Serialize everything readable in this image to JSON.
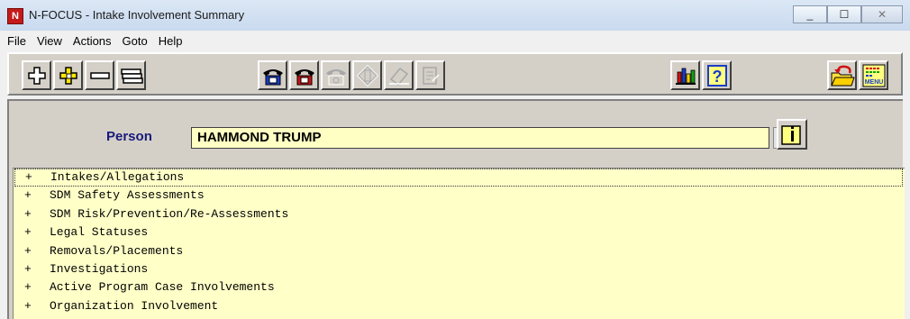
{
  "window": {
    "title": "N-FOCUS - Intake Involvement Summary",
    "app_icon_text": "N",
    "minimize": "_",
    "maximize": "☐",
    "close": "✕"
  },
  "menubar": {
    "items": [
      "File",
      "View",
      "Actions",
      "Goto",
      "Help"
    ]
  },
  "toolbar": {
    "buttons": [
      {
        "icon": "add-icon"
      },
      {
        "icon": "add-special-icon"
      },
      {
        "icon": "remove-icon"
      },
      {
        "icon": "list-icon"
      },
      {
        "icon": "phone-blue-icon"
      },
      {
        "icon": "phone-red-icon"
      },
      {
        "icon": "phone-disabled-icon"
      },
      {
        "icon": "stoplight-disabled-icon"
      },
      {
        "icon": "eraser-disabled-icon"
      },
      {
        "icon": "notes-disabled-icon"
      },
      {
        "icon": "bar-chart-icon"
      },
      {
        "icon": "help-icon"
      },
      {
        "icon": "back-folder-icon"
      },
      {
        "icon": "menu-icon"
      }
    ],
    "menu_text": "MENU"
  },
  "form": {
    "person_label": "Person",
    "person_value": "HAMMOND TRUMP"
  },
  "tree": {
    "expand_symbol": "+",
    "items": [
      "Intakes/Allegations",
      "SDM Safety Assessments",
      "SDM Risk/Prevention/Re-Assessments",
      "Legal Statuses",
      "Removals/Placements",
      "Investigations",
      "Active Program Case Involvements",
      "Organization Involvement"
    ],
    "selected_index": 0
  },
  "colors": {
    "field_bg": "#ffffc4",
    "tree_bg": "#ffffc8",
    "label_color": "#1a1a7a",
    "panel_bg": "#d4d0c8"
  }
}
